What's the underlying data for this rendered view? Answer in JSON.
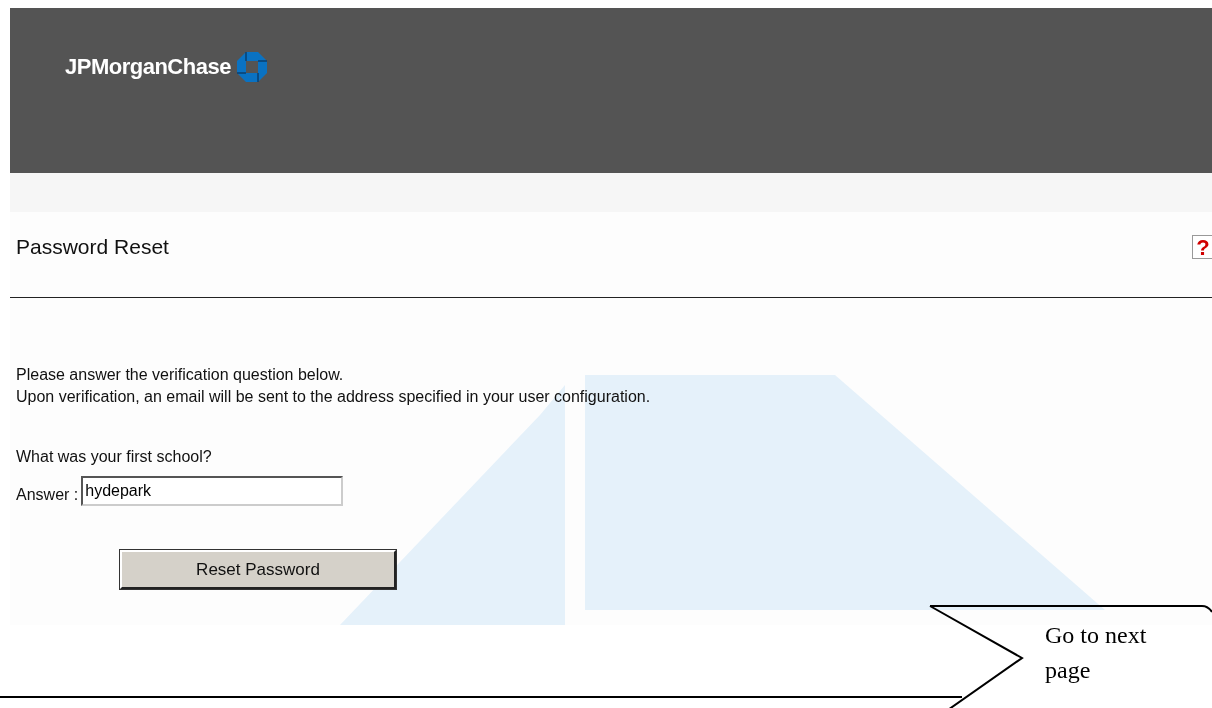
{
  "header": {
    "logo_text": "JPMorganChase"
  },
  "page": {
    "title": "Password Reset",
    "help": "?"
  },
  "intro": [
    "Please answer the verification question below.",
    "Upon verification, an email will be sent to the address specified in your user configuration."
  ],
  "question": {
    "text": "What was your first school?",
    "label": "Answer :",
    "value": "hydepark"
  },
  "submit": {
    "label": "Reset Password"
  },
  "callout": {
    "text": "Go to next page"
  }
}
